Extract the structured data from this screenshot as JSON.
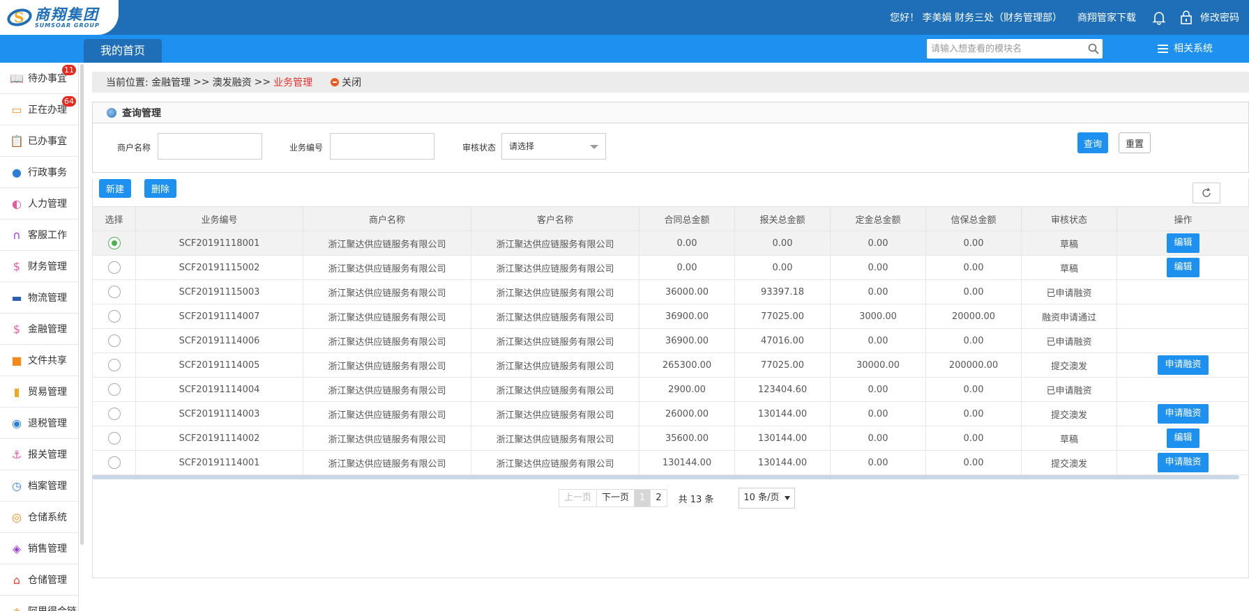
{
  "header": {
    "logo_cn": "商翔集团",
    "logo_en": "SUMSOAR GROUP",
    "greeting": "您好！ 李美娟 财务三处（财务管理部）",
    "download": "商翔管家下载",
    "change_password": "修改密码"
  },
  "nav": {
    "home_tab": "我的首页",
    "search_placeholder": "请输入想查看的模块名",
    "related_systems": "相关系统"
  },
  "sidebar": {
    "items": [
      {
        "label": "待办事宜",
        "icon": "book-icon",
        "badge": "11",
        "color": "#2fa84f"
      },
      {
        "label": "正在办理",
        "icon": "img-icon",
        "badge": "64",
        "color": "#f29b2c"
      },
      {
        "label": "已办事宜",
        "icon": "clipboard-icon",
        "badge": "",
        "color": "#e2453a"
      },
      {
        "label": "行政事务",
        "icon": "user-icon",
        "badge": "",
        "color": "#2d7fd6"
      },
      {
        "label": "人力管理",
        "icon": "users-icon",
        "badge": "",
        "color": "#e25aa5"
      },
      {
        "label": "客服工作",
        "icon": "headset-icon",
        "badge": "",
        "color": "#9b3fd6"
      },
      {
        "label": "财务管理",
        "icon": "finance-icon",
        "badge": "",
        "color": "#e25aa5"
      },
      {
        "label": "物流管理",
        "icon": "truck-icon",
        "badge": "",
        "color": "#2d5fb0"
      },
      {
        "label": "金融管理",
        "icon": "finance-icon",
        "badge": "",
        "color": "#e25aa5"
      },
      {
        "label": "文件共享",
        "icon": "folder-icon",
        "badge": "",
        "color": "#f28b1c"
      },
      {
        "label": "贸易管理",
        "icon": "trade-icon",
        "badge": "",
        "color": "#f2a81d"
      },
      {
        "label": "退税管理",
        "icon": "tax-icon",
        "badge": "",
        "color": "#2d7fd6"
      },
      {
        "label": "报关管理",
        "icon": "anchor-icon",
        "badge": "",
        "color": "#e25aa5"
      },
      {
        "label": "档案管理",
        "icon": "clock-icon",
        "badge": "",
        "color": "#2d7fd6"
      },
      {
        "label": "仓储系统",
        "icon": "camera-icon",
        "badge": "",
        "color": "#f28b1c"
      },
      {
        "label": "销售管理",
        "icon": "layers-icon",
        "badge": "",
        "color": "#9b3fd6"
      },
      {
        "label": "仓储管理",
        "icon": "home-icon",
        "badge": "",
        "color": "#e2453a"
      },
      {
        "label": "阿里得合链",
        "icon": "layers-icon",
        "badge": "",
        "color": "#f28b1c"
      }
    ]
  },
  "breadcrumb": {
    "prefix": "当前位置:",
    "level1": "金融管理",
    "sep": ">>",
    "level2": "澳发融资",
    "current": "业务管理",
    "close": "关闭"
  },
  "query": {
    "title": "查询管理",
    "merchant_label": "商户名称",
    "merchant_value": "",
    "bizno_label": "业务编号",
    "bizno_value": "",
    "status_label": "审核状态",
    "status_value": "请选择",
    "search_btn": "查询",
    "reset_btn": "重置"
  },
  "toolbar": {
    "new_btn": "新建",
    "delete_btn": "删除"
  },
  "table": {
    "headers": [
      "选择",
      "业务编号",
      "商户名称",
      "客户名称",
      "合同总金额",
      "报关总金额",
      "定金总金额",
      "信保总金额",
      "审核状态",
      "操作"
    ],
    "rows": [
      {
        "selected": true,
        "no": "SCF20191118001",
        "merchant": "浙江聚达供应链服务有限公司",
        "customer": "浙江聚达供应链服务有限公司",
        "contract": "0.00",
        "customs": "0.00",
        "deposit": "0.00",
        "credit": "0.00",
        "status": "草稿",
        "action": "编辑"
      },
      {
        "selected": false,
        "no": "SCF20191115002",
        "merchant": "浙江聚达供应链服务有限公司",
        "customer": "浙江聚达供应链服务有限公司",
        "contract": "0.00",
        "customs": "0.00",
        "deposit": "0.00",
        "credit": "0.00",
        "status": "草稿",
        "action": "编辑"
      },
      {
        "selected": false,
        "no": "SCF20191115003",
        "merchant": "浙江聚达供应链服务有限公司",
        "customer": "浙江聚达供应链服务有限公司",
        "contract": "36000.00",
        "customs": "93397.18",
        "deposit": "0.00",
        "credit": "0.00",
        "status": "已申请融资",
        "action": ""
      },
      {
        "selected": false,
        "no": "SCF20191114007",
        "merchant": "浙江聚达供应链服务有限公司",
        "customer": "浙江聚达供应链服务有限公司",
        "contract": "36900.00",
        "customs": "77025.00",
        "deposit": "3000.00",
        "credit": "20000.00",
        "status": "融资申请通过",
        "action": ""
      },
      {
        "selected": false,
        "no": "SCF20191114006",
        "merchant": "浙江聚达供应链服务有限公司",
        "customer": "浙江聚达供应链服务有限公司",
        "contract": "36900.00",
        "customs": "47016.00",
        "deposit": "0.00",
        "credit": "0.00",
        "status": "已申请融资",
        "action": ""
      },
      {
        "selected": false,
        "no": "SCF20191114005",
        "merchant": "浙江聚达供应链服务有限公司",
        "customer": "浙江聚达供应链服务有限公司",
        "contract": "265300.00",
        "customs": "77025.00",
        "deposit": "30000.00",
        "credit": "200000.00",
        "status": "提交澳发",
        "action": "申请融资"
      },
      {
        "selected": false,
        "no": "SCF20191114004",
        "merchant": "浙江聚达供应链服务有限公司",
        "customer": "浙江聚达供应链服务有限公司",
        "contract": "2900.00",
        "customs": "123404.60",
        "deposit": "0.00",
        "credit": "0.00",
        "status": "已申请融资",
        "action": ""
      },
      {
        "selected": false,
        "no": "SCF20191114003",
        "merchant": "浙江聚达供应链服务有限公司",
        "customer": "浙江聚达供应链服务有限公司",
        "contract": "26000.00",
        "customs": "130144.00",
        "deposit": "0.00",
        "credit": "0.00",
        "status": "提交澳发",
        "action": "申请融资"
      },
      {
        "selected": false,
        "no": "SCF20191114002",
        "merchant": "浙江聚达供应链服务有限公司",
        "customer": "浙江聚达供应链服务有限公司",
        "contract": "35600.00",
        "customs": "130144.00",
        "deposit": "0.00",
        "credit": "0.00",
        "status": "草稿",
        "action": "编辑"
      },
      {
        "selected": false,
        "no": "SCF20191114001",
        "merchant": "浙江聚达供应链服务有限公司",
        "customer": "浙江聚达供应链服务有限公司",
        "contract": "130144.00",
        "customs": "130144.00",
        "deposit": "0.00",
        "credit": "0.00",
        "status": "提交澳发",
        "action": "申请融资"
      }
    ]
  },
  "pager": {
    "prev": "上一页",
    "next": "下一页",
    "pages": [
      "1",
      "2"
    ],
    "current": "1",
    "total": "共 13 条",
    "page_size": "10 条/页"
  }
}
